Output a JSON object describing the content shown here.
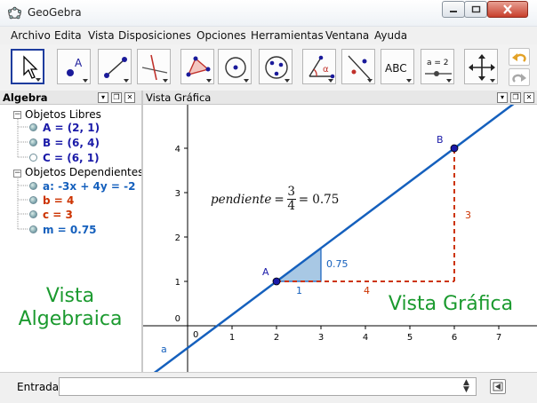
{
  "window": {
    "title": "GeoGebra"
  },
  "menu": [
    "Archivo",
    "Edita",
    "Vista",
    "Disposiciones",
    "Opciones",
    "Herramientas",
    "Ventana",
    "Ayuda"
  ],
  "toolbar": {
    "tools": [
      "move",
      "point",
      "line",
      "perpendicular-line",
      "polygon",
      "circle",
      "conic",
      "angle",
      "reflect",
      "text",
      "slider",
      "move-graphics-view"
    ],
    "point_label": "A",
    "angle_label": "α",
    "text_tool_label": "ABC",
    "slider_tool_label": "a = 2"
  },
  "algebra": {
    "title": "Algebra",
    "free_heading": "Objetos Libres",
    "dependent_heading": "Objetos Dependientes",
    "free_items": [
      {
        "text": "A = (2, 1)",
        "color": "#1a1aa8",
        "shown": true
      },
      {
        "text": "B = (6, 4)",
        "color": "#1a1aa8",
        "shown": true
      },
      {
        "text": "C = (6, 1)",
        "color": "#1a1aa8",
        "shown": false
      }
    ],
    "dependent_items": [
      {
        "text": "a: -3x + 4y = -2",
        "color": "#1560bd",
        "shown": true
      },
      {
        "text": "b = 4",
        "color": "#cc3300",
        "shown": true
      },
      {
        "text": "c = 3",
        "color": "#cc3300",
        "shown": true
      },
      {
        "text": "m = 0.75",
        "color": "#1560bd",
        "shown": true
      }
    ]
  },
  "graphics": {
    "title": "Vista Gráfica",
    "origin_label": "0",
    "formula": {
      "lhs": "pendiente",
      "num": "3",
      "den": "4",
      "rhs": "= 0.75"
    },
    "labels": {
      "A": "A",
      "B": "B",
      "line": "a",
      "rise": "3",
      "run": "4",
      "small_rise": "0.75",
      "small_run": "1"
    }
  },
  "chart_data": {
    "type": "scatter",
    "title": "",
    "xlabel": "",
    "ylabel": "",
    "xlim": [
      -1.1,
      7.8
    ],
    "ylim": [
      -1.2,
      5.0
    ],
    "x_ticks": [
      1,
      2,
      3,
      4,
      5,
      6,
      7
    ],
    "y_ticks": [
      1,
      2,
      3,
      4
    ],
    "grid": false,
    "points": [
      {
        "name": "A",
        "x": 2,
        "y": 1
      },
      {
        "name": "B",
        "x": 6,
        "y": 4
      }
    ],
    "line": {
      "name": "a",
      "equation": "-3x + 4y = -2",
      "slope": 0.75,
      "intercept": -0.5
    },
    "segments": [
      {
        "name": "b",
        "from": [
          2,
          1
        ],
        "to": [
          6,
          1
        ],
        "value": 4
      },
      {
        "name": "c",
        "from": [
          6,
          1
        ],
        "to": [
          6,
          4
        ],
        "value": 3
      }
    ],
    "slope_triangle": {
      "vertices": [
        [
          2,
          1
        ],
        [
          3,
          1
        ],
        [
          3,
          1.75
        ]
      ],
      "run": 1,
      "rise": 0.75
    }
  },
  "overlay": {
    "algebra_caption": [
      "Vista",
      "Algebraica"
    ],
    "graphics_caption": "Vista Gráfica"
  },
  "input_bar": {
    "label": "Entrada:",
    "value": ""
  },
  "colors": {
    "line": "#1560bd",
    "segment": "#cc3300",
    "triangle": "#a8c8e4",
    "caption": "#1b9a2f",
    "point": "#1a1aa8"
  }
}
